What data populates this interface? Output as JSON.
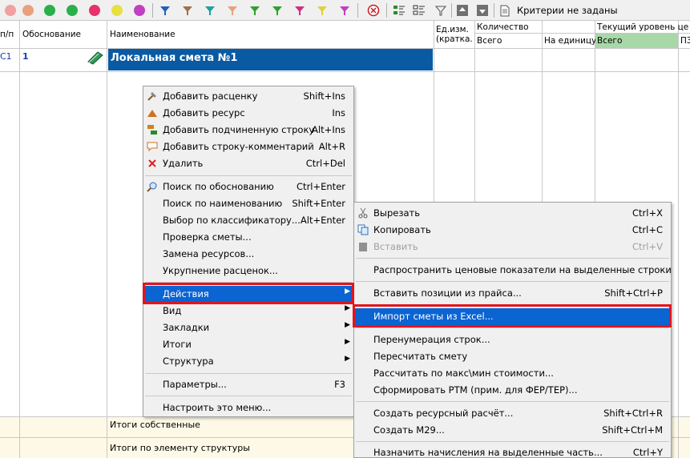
{
  "toolbar": {
    "circles": [
      "#f2a0a0",
      "#e8a080",
      "#2ab04a",
      "#2ab04a",
      "#e8306a",
      "#e8e040",
      "#d0d030",
      "#c040c0"
    ],
    "filters": [
      "#2060c0",
      "#a07050",
      "#20a0a0",
      "#e8a080",
      "#30a030",
      "#30a030",
      "#d03080",
      "#e0d040",
      "#c040c0"
    ],
    "criteria_label": "Критерии не заданы"
  },
  "grid": {
    "headers": {
      "num": "п/п",
      "basis": "Обоснование",
      "name": "Наименование",
      "unit_l1": "Ед.изм.",
      "unit_l2": "(кратка.",
      "qty": "Количество",
      "qty_total": "Всего",
      "qty_per": "На единицу",
      "price": "Текущий уровень цен",
      "price_total": "Всего",
      "pz": "ПЗ"
    },
    "row": {
      "num": "С1",
      "basis": "1",
      "name": "Локальная смета №1"
    },
    "totals": {
      "own": "Итоги собственные",
      "struct": "Итоги по элементу структуры"
    }
  },
  "context_menu": {
    "items": [
      {
        "label": "Добавить расценку",
        "shortcut": "Shift+Ins",
        "icon": "hammer-icon"
      },
      {
        "label": "Добавить ресурс",
        "shortcut": "Ins",
        "icon": "bricks-icon"
      },
      {
        "label": "Добавить подчиненную строку",
        "shortcut": "Alt+Ins",
        "icon": "subrow-icon"
      },
      {
        "label": "Добавить строку-комментарий",
        "shortcut": "Alt+R",
        "icon": "comment-icon"
      },
      {
        "label": "Удалить",
        "shortcut": "Ctrl+Del",
        "icon": "delete-x-icon"
      },
      {
        "label": "Поиск по обоснованию",
        "shortcut": "Ctrl+Enter",
        "icon": "magnifier-icon"
      },
      {
        "label": "Поиск по наименованию",
        "shortcut": "Shift+Enter"
      },
      {
        "label": "Выбор по классификатору...",
        "shortcut": "Alt+Enter"
      },
      {
        "label": "Проверка сметы..."
      },
      {
        "label": "Замена ресурсов..."
      },
      {
        "label": "Укрупнение расценок..."
      },
      {
        "label": "Действия",
        "submenu": true
      },
      {
        "label": "Вид",
        "submenu": true
      },
      {
        "label": "Закладки",
        "submenu": true
      },
      {
        "label": "Итоги",
        "submenu": true
      },
      {
        "label": "Структура",
        "submenu": true
      },
      {
        "label": "Параметры...",
        "shortcut": "F3"
      },
      {
        "label": "Настроить это меню..."
      }
    ]
  },
  "submenu": {
    "items": [
      {
        "label": "Вырезать",
        "shortcut": "Ctrl+X",
        "icon": "scissors-icon"
      },
      {
        "label": "Копировать",
        "shortcut": "Ctrl+C",
        "icon": "copy-icon"
      },
      {
        "label": "Вставить",
        "shortcut": "Ctrl+V",
        "icon": "paste-icon",
        "disabled": true
      },
      {
        "label": "Распространить ценовые показатели на выделенные строки"
      },
      {
        "label": "Вставить позиции из прайса...",
        "shortcut": "Shift+Ctrl+P"
      },
      {
        "label": "Импорт сметы из Excel..."
      },
      {
        "label": "Перенумерация строк..."
      },
      {
        "label": "Пересчитать смету"
      },
      {
        "label": "Рассчитать по макс\\мин стоимости..."
      },
      {
        "label": "Сформировать РТМ (прим. для ФЕР/ТЕР)..."
      },
      {
        "label": "Создать ресурсный расчёт...",
        "shortcut": "Shift+Ctrl+R"
      },
      {
        "label": "Создать М29...",
        "shortcut": "Shift+Ctrl+M"
      },
      {
        "label": "Назначить начисления на выделенные часть...",
        "shortcut": "Ctrl+Y"
      }
    ]
  }
}
